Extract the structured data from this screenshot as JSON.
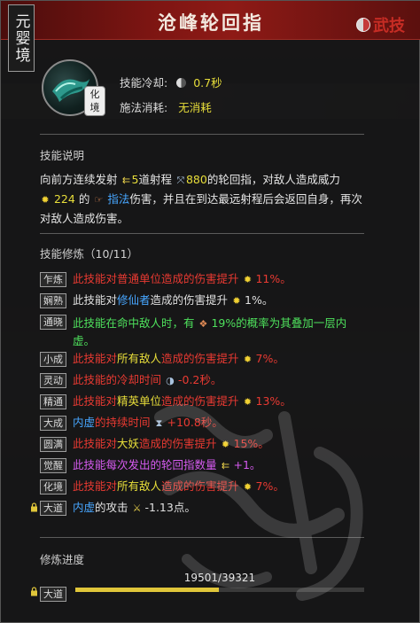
{
  "window": {
    "title": "沧峰轮回指",
    "realm_tag": "元婴境",
    "corner_label": "武技"
  },
  "skill": {
    "icon_name": "palm-strike-icon",
    "badge": "化境",
    "cooldown_label": "技能冷却:",
    "cooldown_value": "0.7秒",
    "cost_label": "施法消耗:",
    "cost_value": "无消耗"
  },
  "description": {
    "header": "技能说明",
    "line1_a": "向前方连续发射",
    "count": "5",
    "line1_b": "道射程",
    "range": "880",
    "line1_c": "的轮回指，对敌人造成威力",
    "power": "224",
    "line2_a": "的",
    "damage_type": "指法",
    "line2_b": "伤害，并且在到达最远射程后会返回自身，再次",
    "line3": "对敌人造成伤害。"
  },
  "cultivation": {
    "header": "技能修炼（10/11）",
    "items": [
      {
        "tag": "乍炼",
        "parts": [
          {
            "text": "此技能对普通单位造成的伤害提升 ",
            "color": "red"
          },
          {
            "text": "11%。",
            "color": "red"
          }
        ]
      },
      {
        "tag": "娴熟",
        "parts": [
          {
            "text": "此技能对",
            "color": "white"
          },
          {
            "text": "修仙者",
            "color": "blue"
          },
          {
            "text": "造成的伤害提升 ",
            "color": "white"
          },
          {
            "text": "1%。",
            "color": "white"
          }
        ]
      },
      {
        "tag": "通晓",
        "parts": [
          {
            "text": "此技能在命中敌人时，有 ",
            "color": "green"
          },
          {
            "text": "19%的概率为其叠加一层内",
            "color": "green"
          }
        ],
        "line2": "虚。"
      },
      {
        "tag": "小成",
        "parts": [
          {
            "text": "此技能对",
            "color": "red"
          },
          {
            "text": "所有敌人",
            "color": "yellow"
          },
          {
            "text": "造成的伤害提升 ",
            "color": "red"
          },
          {
            "text": "7%。",
            "color": "red"
          }
        ]
      },
      {
        "tag": "灵动",
        "parts": [
          {
            "text": "此技能的冷却时间 ",
            "color": "red"
          },
          {
            "text": "-0.2秒。",
            "color": "red"
          }
        ]
      },
      {
        "tag": "精通",
        "parts": [
          {
            "text": "此技能对",
            "color": "red"
          },
          {
            "text": "精英单位",
            "color": "yellow"
          },
          {
            "text": "造成的伤害提升 ",
            "color": "red"
          },
          {
            "text": "13%。",
            "color": "red"
          }
        ]
      },
      {
        "tag": "大成",
        "parts": [
          {
            "text": "内虚",
            "color": "blue"
          },
          {
            "text": "的持续时间 ",
            "color": "red"
          },
          {
            "text": "+10.8秒。",
            "color": "red"
          }
        ]
      },
      {
        "tag": "圆满",
        "parts": [
          {
            "text": "此技能对",
            "color": "red"
          },
          {
            "text": "大妖",
            "color": "yellow"
          },
          {
            "text": "造成的伤害提升 ",
            "color": "red"
          },
          {
            "text": "15%。",
            "color": "red"
          }
        ]
      },
      {
        "tag": "觉醒",
        "parts": [
          {
            "text": "此技能每次发出的轮回指数量 ",
            "color": "purple"
          },
          {
            "text": "+1。",
            "color": "purple"
          }
        ]
      },
      {
        "tag": "化境",
        "parts": [
          {
            "text": "此技能对",
            "color": "red"
          },
          {
            "text": "所有敌人",
            "color": "yellow"
          },
          {
            "text": "造成的伤害提升 ",
            "color": "red"
          },
          {
            "text": "7%。",
            "color": "red"
          }
        ]
      },
      {
        "tag": "大道",
        "locked": true,
        "parts": [
          {
            "text": "内虚",
            "color": "blue"
          },
          {
            "text": "的攻击 ",
            "color": "white"
          },
          {
            "text": "-1.13点。",
            "color": "white"
          }
        ]
      }
    ]
  },
  "progress": {
    "header": "修炼进度",
    "tag": "大道",
    "current": 19501,
    "max": 39321,
    "text": "19501/39321",
    "fraction": 0.496
  }
}
